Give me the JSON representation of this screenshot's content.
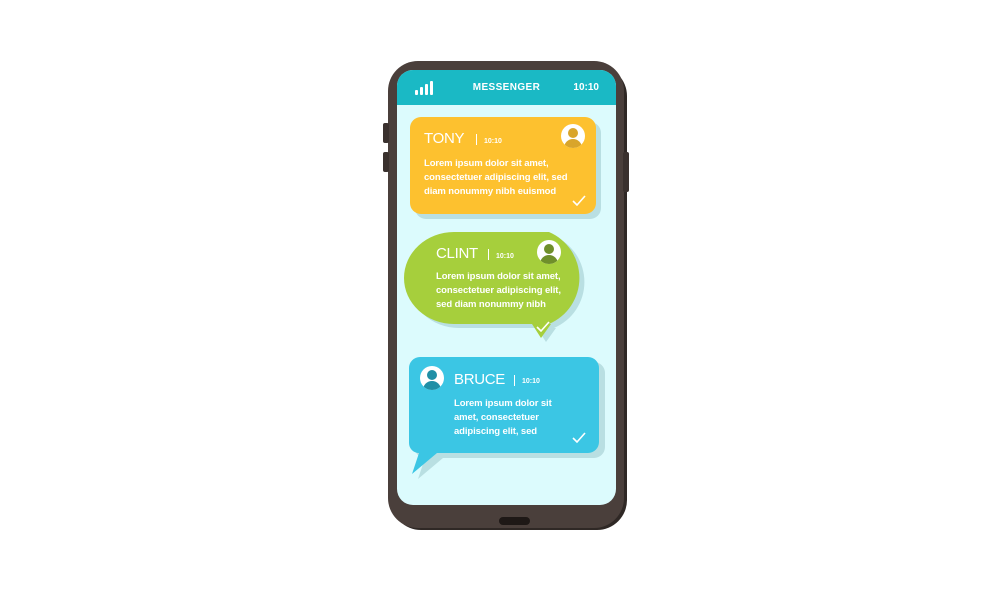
{
  "app": {
    "title": "MESSENGER",
    "time": "10:10"
  },
  "colors": {
    "header": "#1ab9c5",
    "screen": "#dcfbfd",
    "tony": "#fdc12f",
    "clint": "#a6cf3c",
    "bruce": "#3bc6e4"
  },
  "messages": [
    {
      "sender": "TONY",
      "time": "10:10",
      "lines": [
        "Lorem ipsum dolor sit amet,",
        "consectetuer adipiscing elit, sed",
        "diam nonummy nibh euismod"
      ],
      "avatar_icon": "user-avatar-icon",
      "status_icon": "checkmark-icon"
    },
    {
      "sender": "CLINT",
      "time": "10:10",
      "lines": [
        "Lorem ipsum dolor sit amet,",
        "consectetuer adipiscing elit,",
        "sed diam nonummy nibh"
      ],
      "avatar_icon": "user-avatar-icon",
      "status_icon": "checkmark-icon"
    },
    {
      "sender": "BRUCE",
      "time": "10:10",
      "lines": [
        "Lorem ipsum dolor sit",
        "amet, consectetuer",
        "adipiscing elit, sed"
      ],
      "avatar_icon": "user-avatar-icon",
      "status_icon": "checkmark-icon"
    }
  ]
}
